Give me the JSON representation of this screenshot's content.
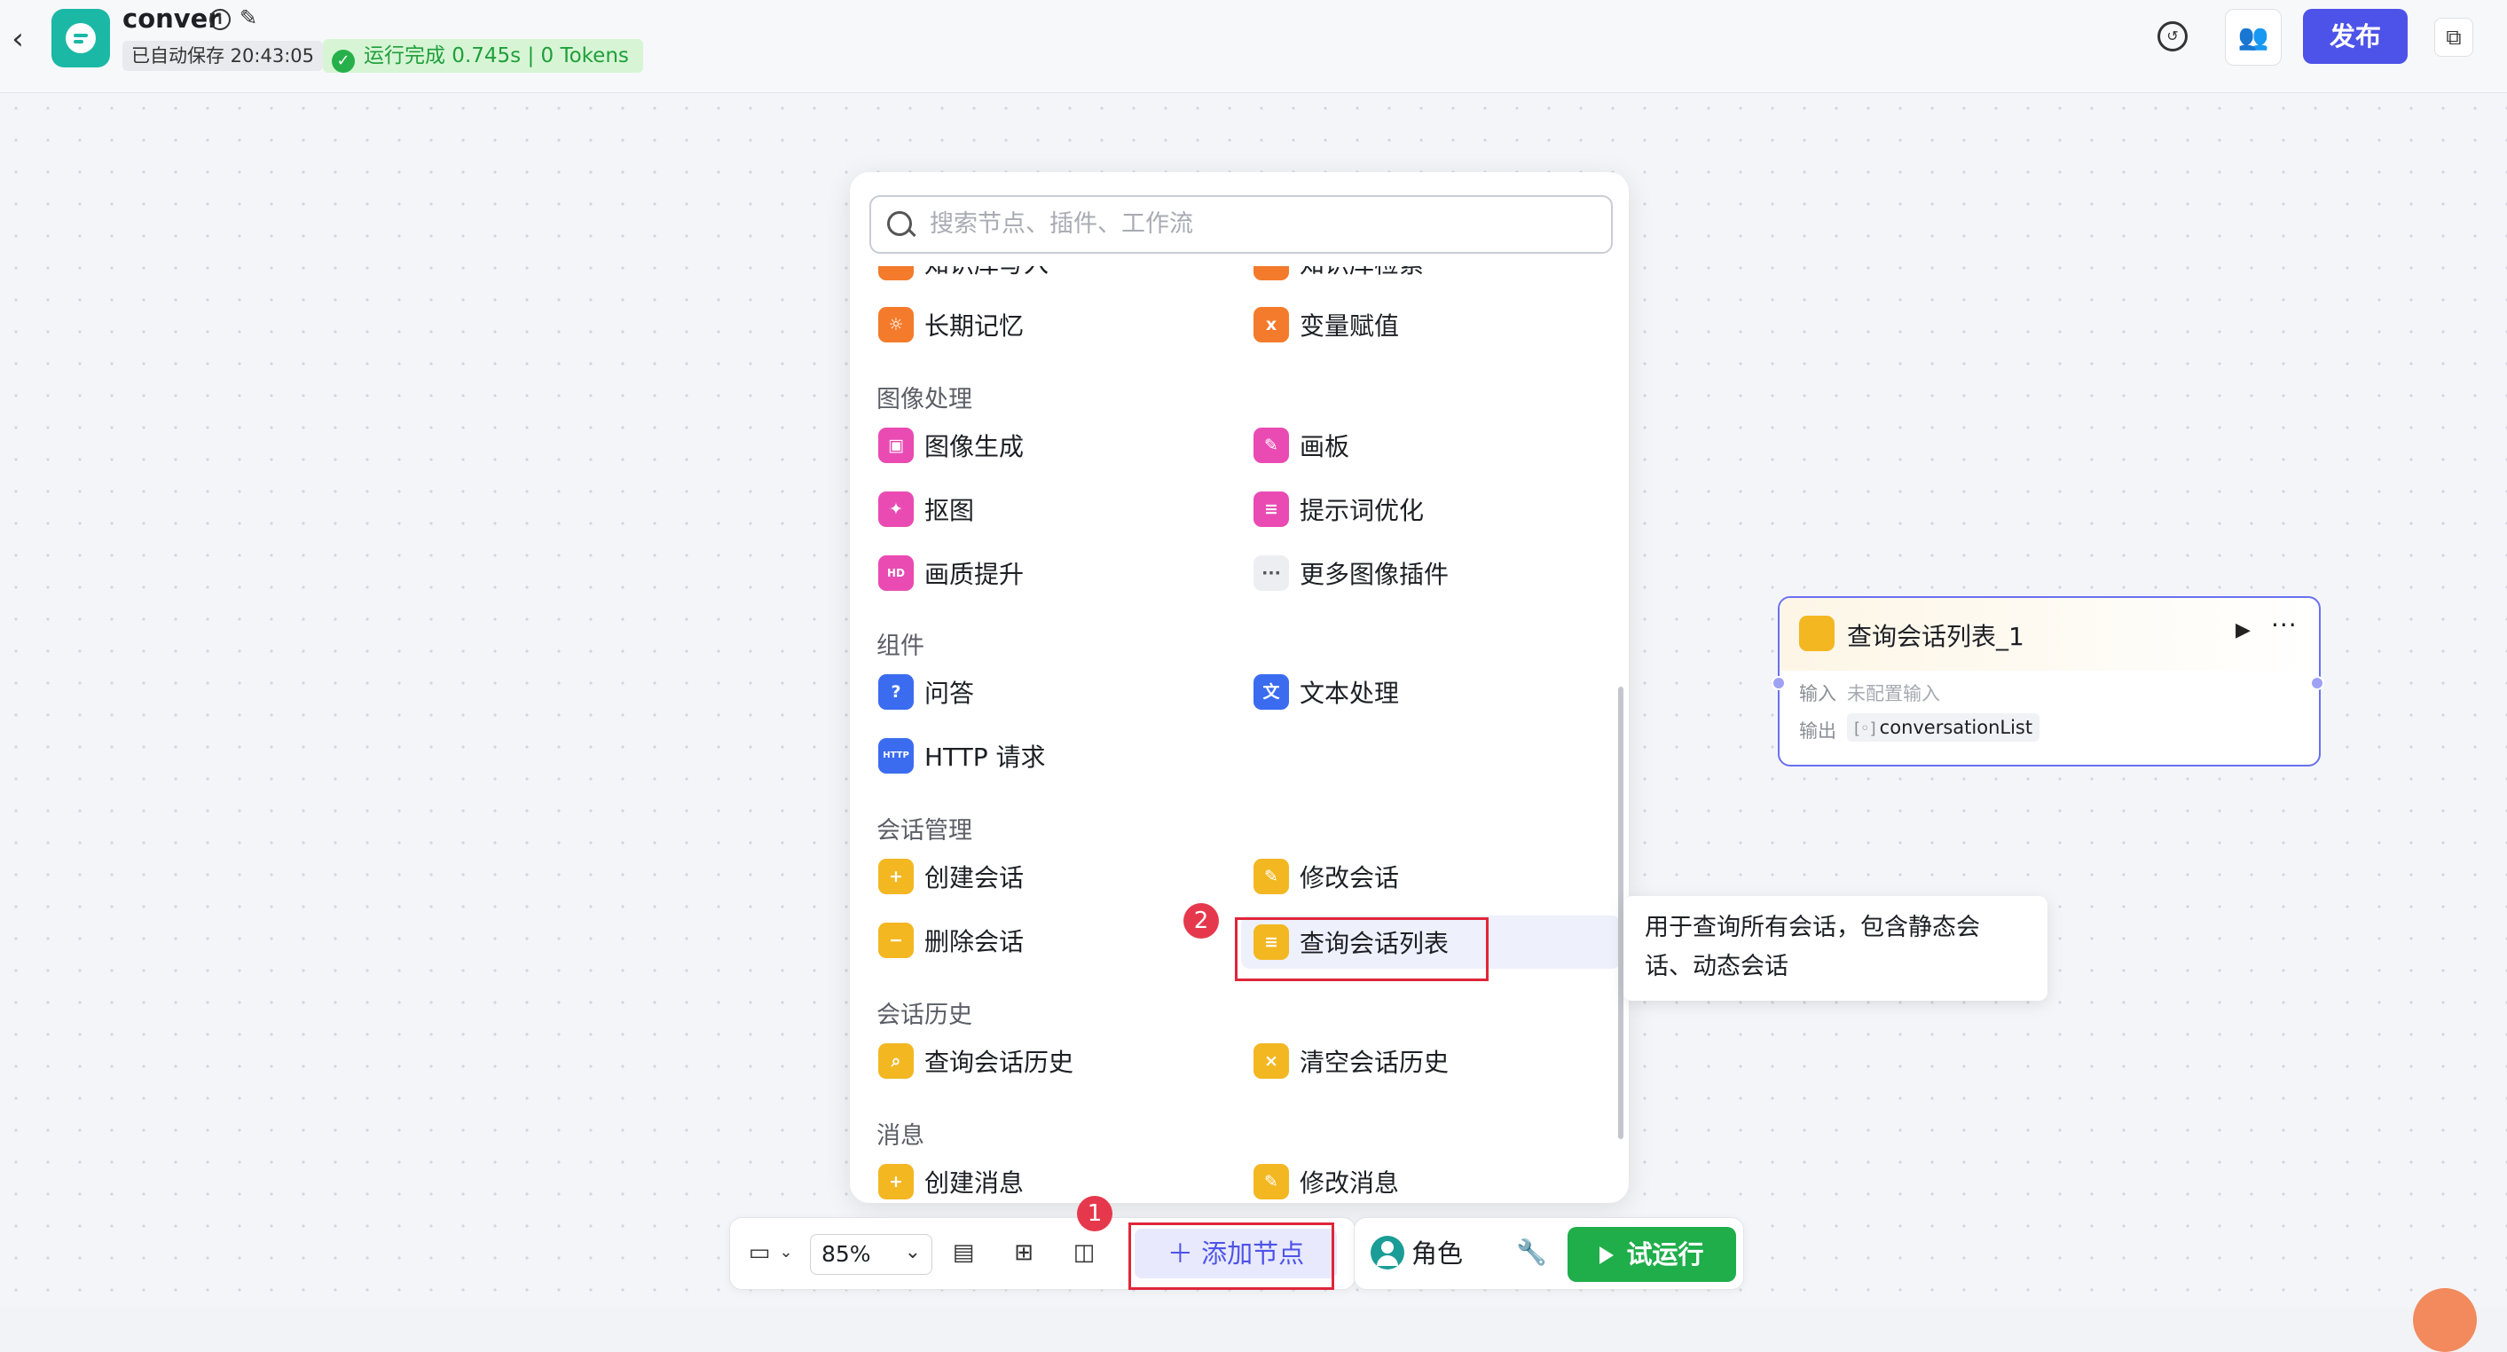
{
  "header": {
    "back_icon": "‹",
    "app_name": "conver",
    "autosave": "已自动保存 20:43:05",
    "run_status": "运行完成 0.745s | 0 Tokens",
    "publish_label": "发布"
  },
  "picker": {
    "search_placeholder": "搜索节点、插件、工作流",
    "partial_top": [
      "知识库写入",
      "知识库检索"
    ],
    "rows_memory": [
      "长期记忆",
      "变量赋值"
    ],
    "section_image": "图像处理",
    "image_items": [
      "图像生成",
      "画板",
      "抠图",
      "提示词优化",
      "画质提升",
      "更多图像插件"
    ],
    "section_components": "组件",
    "component_items": [
      "问答",
      "文本处理",
      "HTTP 请求"
    ],
    "section_conversation": "会话管理",
    "conversation_items": [
      "创建会话",
      "修改会话",
      "删除会话",
      "查询会话列表"
    ],
    "section_history": "会话历史",
    "history_items": [
      "查询会话历史",
      "清空会话历史"
    ],
    "section_message": "消息",
    "message_items": [
      "创建消息",
      "修改消息"
    ]
  },
  "tooltip": {
    "text": "用于查询所有会话，包含静态会话、动态会话"
  },
  "node": {
    "title": "查询会话列表_1",
    "input_label": "输入",
    "input_value": "未配置输入",
    "output_label": "输出",
    "output_value": "conversationList",
    "output_type_icon": "[◦]"
  },
  "toolbar": {
    "zoom": "85%",
    "add_node_label": "添加节点",
    "role_label": "角色",
    "test_run_label": "试运行"
  },
  "annotations": {
    "badge1": "1",
    "badge2": "2"
  }
}
